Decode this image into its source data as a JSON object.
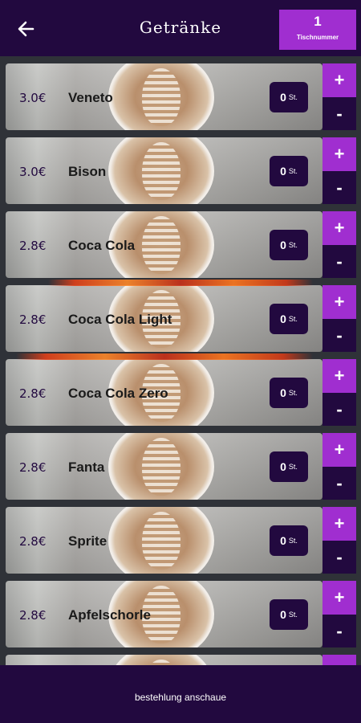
{
  "header": {
    "title": "Getränke",
    "table_number": "1",
    "table_label": "Tischnummer"
  },
  "quantity_unit": "St.",
  "items": [
    {
      "price": "3.0€",
      "name": "Veneto",
      "qty": "0"
    },
    {
      "price": "3.0€",
      "name": "Bison",
      "qty": "0"
    },
    {
      "price": "2.8€",
      "name": "Coca Cola",
      "qty": "0"
    },
    {
      "price": "2.8€",
      "name": "Coca Cola Light",
      "qty": "0"
    },
    {
      "price": "2.8€",
      "name": "Coca Cola Zero",
      "qty": "0"
    },
    {
      "price": "2.8€",
      "name": "Fanta",
      "qty": "0"
    },
    {
      "price": "2.8€",
      "name": "Sprite",
      "qty": "0"
    },
    {
      "price": "2.8€",
      "name": "Apfelschorle",
      "qty": "0"
    },
    {
      "price": "",
      "name": "",
      "qty": ""
    }
  ],
  "buttons": {
    "plus": "+",
    "minus": "-"
  },
  "footer": {
    "button_label": "bestehlung anschaue"
  },
  "colors": {
    "dark_purple": "#22093f",
    "accent_purple": "#a02ed0"
  }
}
